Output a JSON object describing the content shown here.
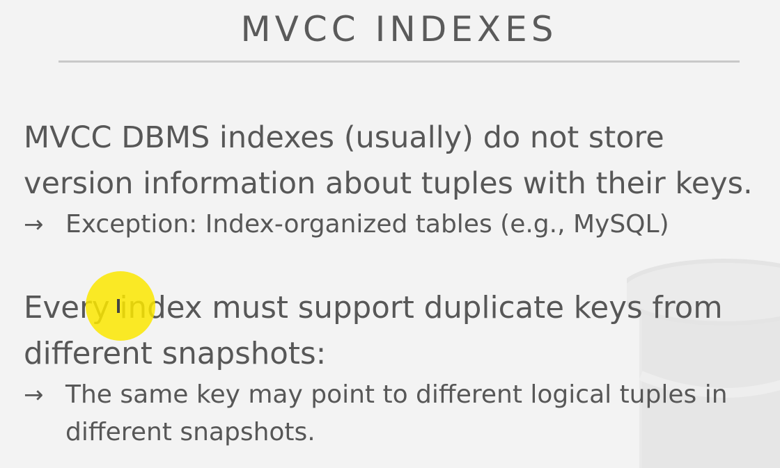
{
  "slide": {
    "title": "MVCC INDEXES",
    "paragraphs": [
      {
        "lines": [
          "MVCC DBMS indexes (usually) do not store",
          "version information about tuples with their keys."
        ],
        "bullets": [
          {
            "arrow": "→",
            "lines": [
              "Exception: Index-organized tables (e.g., MySQL)"
            ]
          }
        ]
      },
      {
        "lines": [
          "Every index must support duplicate keys from",
          "different snapshots:"
        ],
        "bullets": [
          {
            "arrow": "→",
            "lines": [
              "The same key may point to different logical tuples in",
              "different snapshots."
            ]
          }
        ]
      }
    ]
  },
  "colors": {
    "background": "#f3f3f3",
    "text": "#575757",
    "rule": "#c8c8c8",
    "cursor_highlight": "#fae600"
  },
  "icons": [
    "database-watermark-icon",
    "pointer-highlight-icon"
  ]
}
